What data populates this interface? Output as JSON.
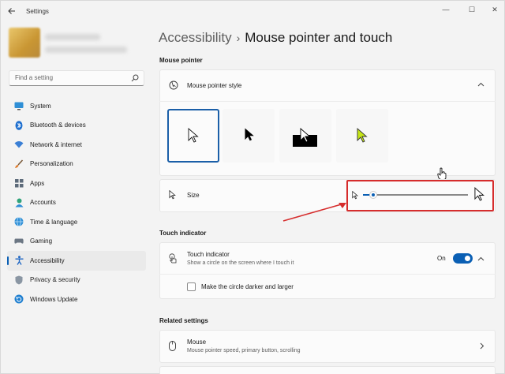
{
  "window": {
    "title": "Settings",
    "controls": [
      "—",
      "☐",
      "✕"
    ]
  },
  "sidebar": {
    "search_placeholder": "Find a setting",
    "items": [
      {
        "label": "System",
        "icon": "monitor-icon"
      },
      {
        "label": "Bluetooth & devices",
        "icon": "bluetooth-icon"
      },
      {
        "label": "Network & internet",
        "icon": "wifi-icon"
      },
      {
        "label": "Personalization",
        "icon": "brush-icon"
      },
      {
        "label": "Apps",
        "icon": "apps-icon"
      },
      {
        "label": "Accounts",
        "icon": "person-icon"
      },
      {
        "label": "Time & language",
        "icon": "globe-icon"
      },
      {
        "label": "Gaming",
        "icon": "controller-icon"
      },
      {
        "label": "Accessibility",
        "icon": "accessibility-icon"
      },
      {
        "label": "Privacy & security",
        "icon": "shield-icon"
      },
      {
        "label": "Windows Update",
        "icon": "update-icon"
      }
    ],
    "active_index": 8
  },
  "breadcrumb": {
    "parent": "Accessibility",
    "separator": "›",
    "current": "Mouse pointer and touch"
  },
  "mouse_pointer": {
    "section_title": "Mouse pointer",
    "style_label": "Mouse pointer style",
    "style_options": [
      "white",
      "black",
      "inverted",
      "custom"
    ],
    "selected_style": "white",
    "size_label": "Size",
    "size_value": 0.1
  },
  "touch_indicator": {
    "section_title": "Touch indicator",
    "label": "Touch indicator",
    "description": "Show a circle on the screen where I touch it",
    "toggle_state": "On",
    "checkbox_label": "Make the circle darker and larger"
  },
  "related": {
    "section_title": "Related settings",
    "mouse_label": "Mouse",
    "mouse_description": "Mouse pointer speed, primary button, scrolling"
  },
  "colors": {
    "accent": "#0a5fb4",
    "annotation": "#d62d2d"
  }
}
